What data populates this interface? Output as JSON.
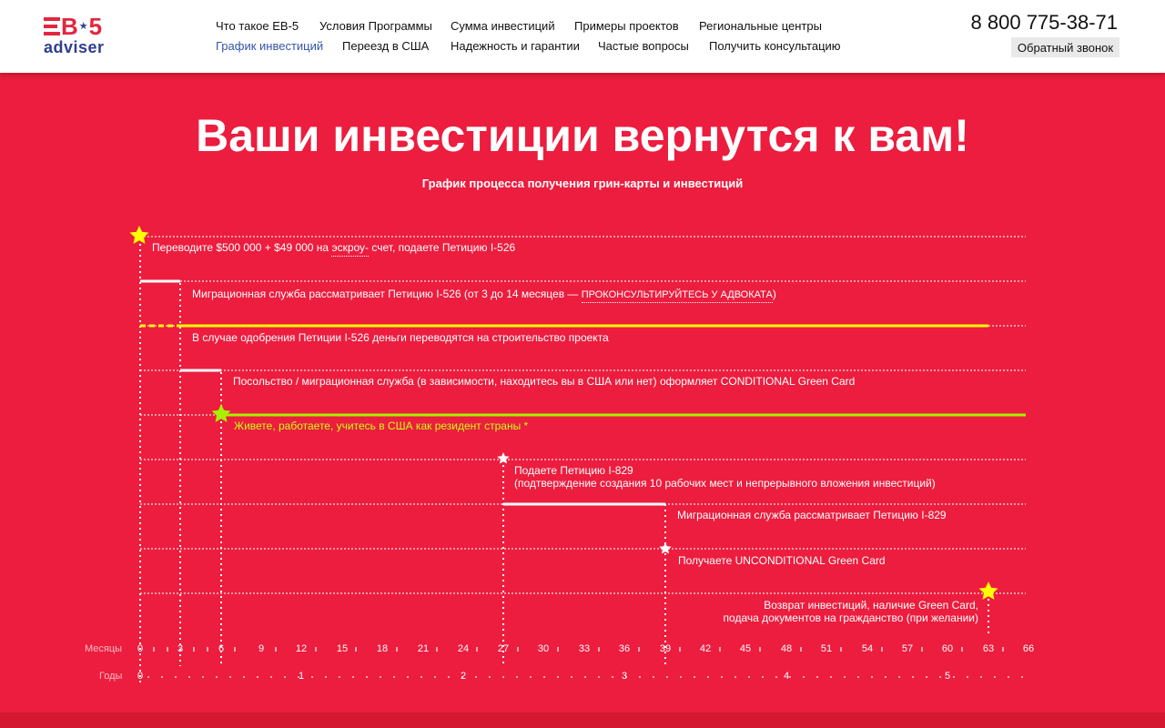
{
  "header": {
    "logo": {
      "top": "EB",
      "star": "★",
      "five": "5",
      "bottom": "adviser"
    },
    "nav_row1": [
      "Что такое EB-5",
      "Условия Программы",
      "Сумма инвестиций",
      "Примеры проектов",
      "Региональные центры"
    ],
    "nav_row2": [
      "График инвестиций",
      "Переезд в США",
      "Надежность и гарантии",
      "Частые вопросы",
      "Получить консультацию"
    ],
    "active_nav": "График инвестиций",
    "phone": "8 800 775-38-71",
    "callback_label": "Обратный звонок"
  },
  "hero": {
    "title": "Ваши инвестиции вернутся к вам!",
    "subtitle": "График процесса получения грин-карты и инвестиций"
  },
  "timeline": {
    "steps": [
      {
        "pre": "Переводите $500 000 + $49 000 на ",
        "link": "эскроу-",
        "post": " счет, подаете Петицию I-526"
      },
      {
        "pre": "Миграционная служба рассматривает Петицию I-526 (от 3 до 14 месяцев — ",
        "link": "ПРОКОНСУЛЬТИРУЙТЕСЬ У АДВОКАТА",
        "post": ")"
      },
      {
        "text": "В случае одобрения Петиции I-526 деньги переводятся на строительство проекта"
      },
      {
        "text": "Посольство / миграционная служба (в зависимости, находитесь вы в США или нет) оформляет CONDITIONAL Green Card"
      },
      {
        "text": "Живете, работаете, учитесь в США как резидент страны *"
      },
      {
        "line1": "Подаете Петицию I-829",
        "line2": "(подтверждение создания 10 рабочих мест и непрерывного вложения инвестиций)"
      },
      {
        "text": "Миграционная служба рассматривает Петицию I-829"
      },
      {
        "text": "Получаете UNCONDITIONAL Green Card"
      },
      {
        "line1": "Возврат инвестиций, наличие Green Card,",
        "line2": "подача документов на гражданство (при желании)"
      }
    ],
    "months_label": "Месяцы",
    "years_label": "Годы",
    "month_ticks": [
      "0",
      "3",
      "6",
      "9",
      "12",
      "15",
      "18",
      "21",
      "24",
      "27",
      "30",
      "33",
      "36",
      "39",
      "42",
      "45",
      "48",
      "51",
      "54",
      "57",
      "60",
      "63",
      "66"
    ],
    "year_ticks": [
      "0",
      "1",
      "2",
      "3",
      "4",
      "5"
    ],
    "colors": {
      "background": "#ec1d3e",
      "yellow": "#ffff00",
      "green": "#a8f000",
      "white": "#ffffff"
    }
  }
}
